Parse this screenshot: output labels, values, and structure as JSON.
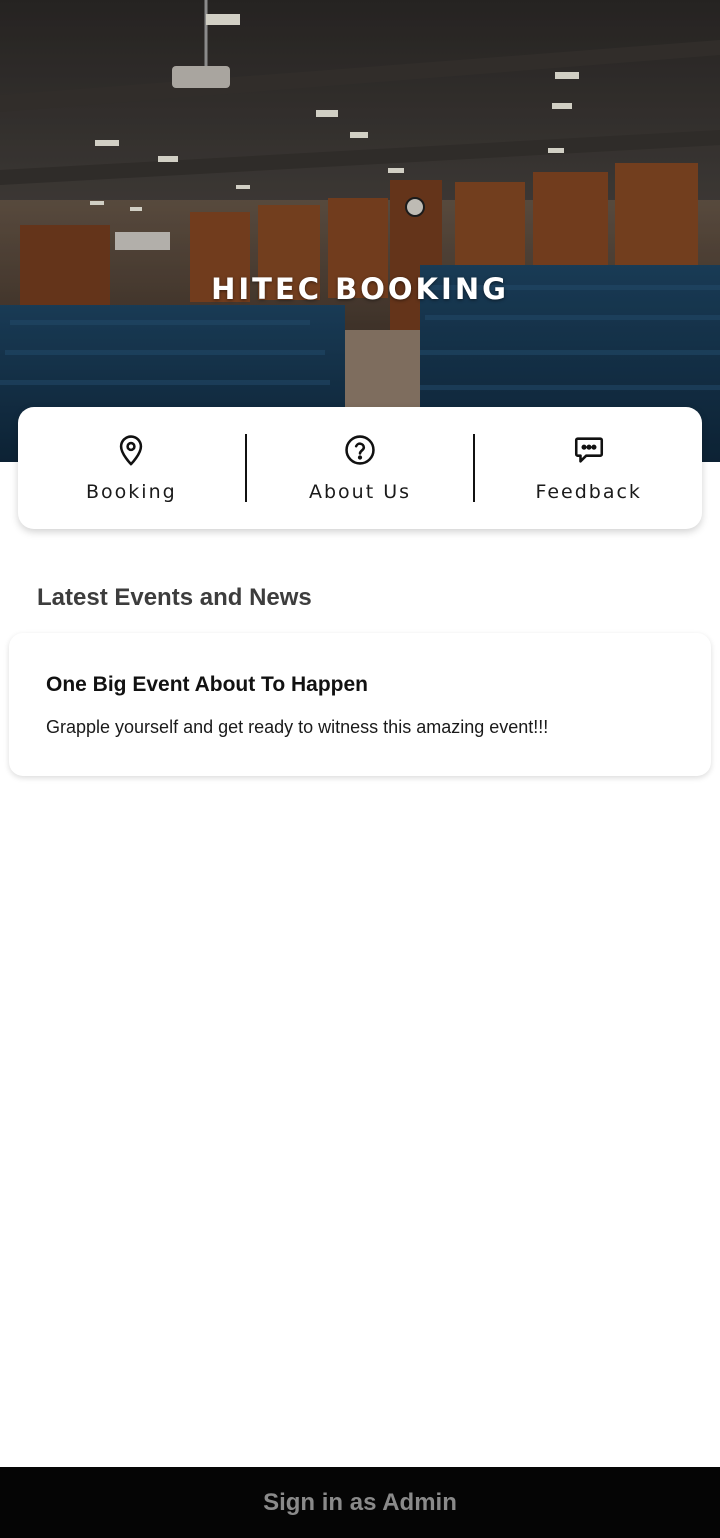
{
  "app": {
    "title": "HITEC BOOKING"
  },
  "quick_nav": [
    {
      "label": "Booking",
      "icon": "map-pin-icon"
    },
    {
      "label": "About Us",
      "icon": "help-circle-icon"
    },
    {
      "label": "Feedback",
      "icon": "message-dots-icon"
    }
  ],
  "events": {
    "section_title": "Latest Events and News",
    "items": [
      {
        "title": "One Big Event About To Happen",
        "body": "Grapple yourself and get ready to witness this amazing event!!!"
      }
    ]
  },
  "footer": {
    "admin_label": "Sign in as Admin"
  },
  "colors": {
    "seat_blue": "#1d3f5c",
    "wood_panel": "#8a4a24",
    "admin_bar": "#050505",
    "admin_text": "#8a8a8a"
  }
}
